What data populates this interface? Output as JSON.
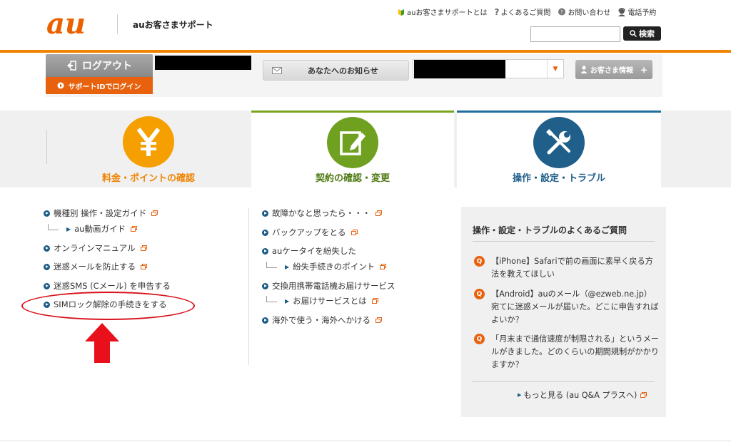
{
  "header": {
    "logo_text": "au",
    "site_title": "auお客さまサポート",
    "top_links": [
      {
        "label": "auお客さまサポートとは",
        "icon": "beginner-leaf-icon"
      },
      {
        "label": "よくあるご質問",
        "icon": "question-icon"
      },
      {
        "label": "お問い合わせ",
        "icon": "chat-bubble-icon"
      },
      {
        "label": "電話予約",
        "icon": "operator-icon"
      }
    ],
    "search": {
      "placeholder": "",
      "button_label": "検索"
    }
  },
  "userbar": {
    "logout_label": "ログアウト",
    "login_label": "サポートIDでログイン",
    "notice_label": "あなたへのお知らせ",
    "customer_info_label": "お客さま情報"
  },
  "categories": [
    {
      "label": "料金・ポイントの確認",
      "icon": "yen-icon",
      "color": "#f5a000"
    },
    {
      "label": "契約の確認・変更",
      "icon": "edit-document-icon",
      "color": "#70a020"
    },
    {
      "label": "操作・設定・トラブル",
      "icon": "tools-icon",
      "color": "#1f5f8a"
    }
  ],
  "left_links": [
    {
      "label": "機種別 操作・設定ガイド"
    },
    {
      "label": "au動画ガイド"
    },
    {
      "label": "オンラインマニュアル"
    },
    {
      "label": "迷惑メールを防止する"
    },
    {
      "label": "迷惑SMS (Cメール) を申告する"
    },
    {
      "label": "SIMロック解除の手続きをする"
    }
  ],
  "middle_links": [
    {
      "label": "故障かなと思ったら・・・"
    },
    {
      "label": "バックアップをとる"
    },
    {
      "label": "auケータイを紛失した"
    },
    {
      "label": "紛失手続きのポイント"
    },
    {
      "label": "交換用携帯電話機お届けサービス"
    },
    {
      "label": "お届けサービスとは"
    },
    {
      "label": "海外で使う・海外へかける"
    }
  ],
  "faq": {
    "title": "操作・設定・トラブルのよくあるご質問",
    "badge": "Q",
    "items": [
      {
        "text": "【iPhone】Safariで前の画面に素早く戻る方法を教えてほしい"
      },
      {
        "text": "【Android】auのメール（@ezweb.ne.jp）宛てに迷惑メールが届いた。どこに申告すればよいか？"
      },
      {
        "text": "「月末まで通信速度が制限される」というメールがきました。どのくらいの期間規制がかかりますか？"
      }
    ],
    "more_label": "もっと見る (au Q&A プラスへ)"
  }
}
